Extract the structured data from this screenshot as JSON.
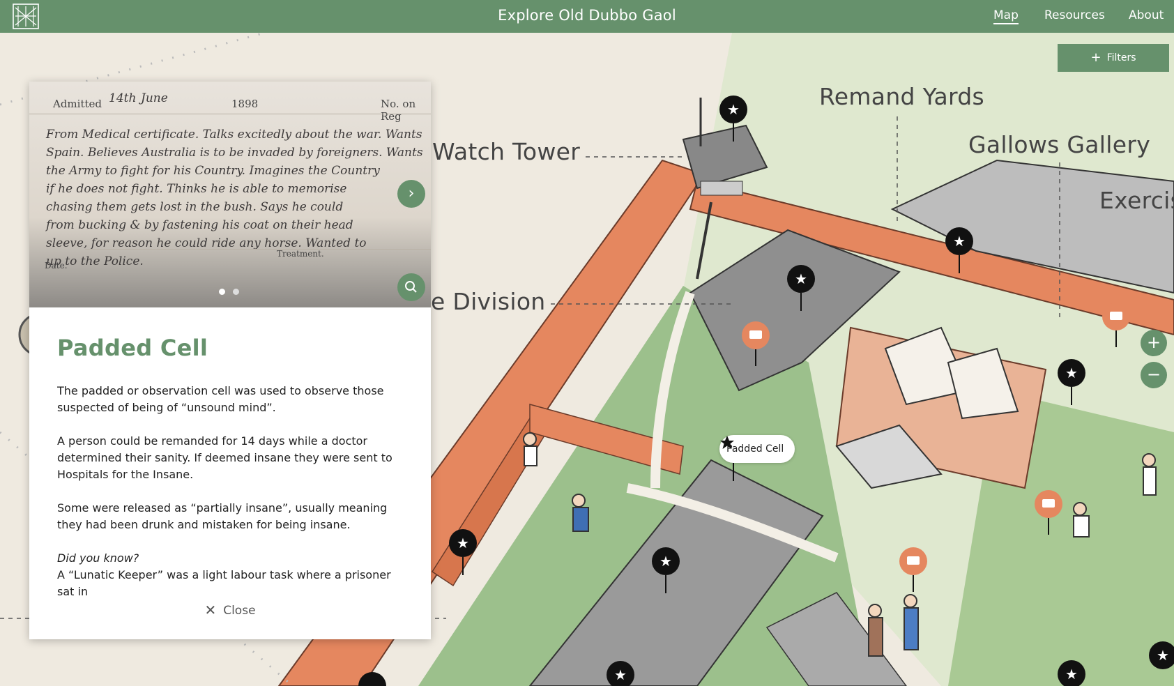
{
  "header": {
    "title": "Explore Old Dubbo Gaol",
    "nav": [
      {
        "label": "Map",
        "active": true
      },
      {
        "label": "Resources",
        "active": false
      },
      {
        "label": "About",
        "active": false
      }
    ]
  },
  "map": {
    "filters_label": "Filters",
    "zoom_in": "+",
    "zoom_out": "−",
    "area_labels": {
      "remand_yards": "Remand Yards",
      "gallows_gallery": "Gallows Gallery",
      "watch_tower": "Watch Tower",
      "exercise": "Exercis",
      "division": "ale Division"
    },
    "selected_pin_label": "Padded Cell",
    "colors": {
      "brand_green": "#66916c",
      "pin_orange": "#e5875f",
      "pin_black": "#111111"
    }
  },
  "panel": {
    "photo": {
      "admitted": "Admitted",
      "day": "14th",
      "month": "June",
      "year": "1898",
      "no_on_reg": "No. on Reg",
      "handwriting": [
        "From Medical certificate. Talks excitedly about the war. Wants",
        "Spain. Believes Australia is to be invaded by foreigners. Wants",
        "the Army to fight for his Country. Imagines the Country",
        "if he does not fight. Thinks he is able to memorise",
        "chasing them gets lost in the bush. Says he could",
        "from bucking & by fastening his coat on their head",
        "sleeve, for reason he could ride any horse. Wanted to",
        "up to the Police."
      ],
      "date_label": "Date.",
      "treatment_label": "Treatment.",
      "slide_count": 2,
      "current_slide": 1
    },
    "title": "Padded Cell",
    "paragraphs": [
      "The padded or observation cell was used to observe those suspected of being of “unsound mind”.",
      "A person could be remanded for 14 days while a doctor determined their sanity. If deemed insane they were sent to Hospitals for the Insane.",
      "Some were released as “partially insane”, usually meaning they had been drunk and mistaken for being insane."
    ],
    "did_you_know": "Did you know?",
    "did_you_know_text": "A “Lunatic Keeper” was a light labour task where a prisoner sat in",
    "close_label": "Close"
  }
}
